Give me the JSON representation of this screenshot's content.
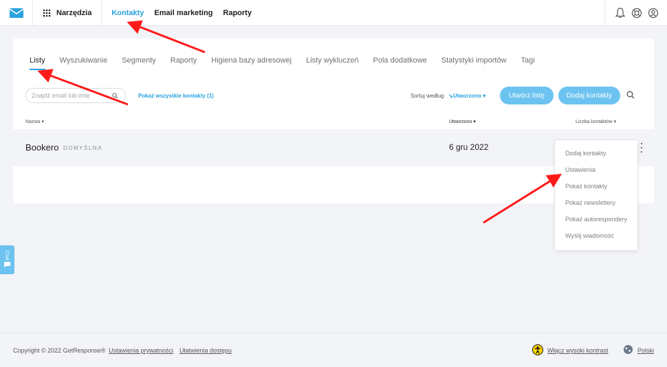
{
  "topbar": {
    "tools_label": "Narzędzia",
    "nav": [
      "Kontakty",
      "Email marketing",
      "Raporty"
    ],
    "active_nav": "Kontakty",
    "icons": [
      "bell-icon",
      "help-icon",
      "account-icon"
    ]
  },
  "tabs": [
    "Listy",
    "Wyszukiwanie",
    "Segmenty",
    "Raporty",
    "Higiena bazy adresowej",
    "Listy wykluczeń",
    "Pola dodatkowe",
    "Statystyki importów",
    "Tagi"
  ],
  "active_tab": "Listy",
  "toolbar": {
    "search_placeholder": "Znajdź email lub imię",
    "show_all": "Pokaż wszystkie kontakty (1)",
    "sort_label": "Sortuj według",
    "sort_value": "Utworzono",
    "create_button": "Utwórz listę",
    "add_button": "Dodaj kontakty"
  },
  "table": {
    "headers": [
      "Nazwa",
      "Utworzono",
      "Liczba kontaktów"
    ],
    "rows": [
      {
        "name": "Bookero",
        "badge": "DOMYŚLNA",
        "created": "6 gru 2022"
      }
    ]
  },
  "dropdown": [
    "Dodaj kontakty",
    "Ustawienia",
    "Pokaż kontakty",
    "Pokaż newslettery",
    "Pokaż autorespondery",
    "Wyślij wiadomość"
  ],
  "chat": {
    "label": "Czat"
  },
  "footer": {
    "copyright": "Copyright © 2022 GetResponse®",
    "privacy": "Ustawienia prywatności",
    "accessibility": "Ułatwienia dostępu",
    "contrast": "Włącz wysoki kontrast",
    "language": "Polski"
  },
  "colors": {
    "accent": "#2aa2de",
    "button": "#6cc3f0",
    "annotation": "#ff1a1a"
  }
}
